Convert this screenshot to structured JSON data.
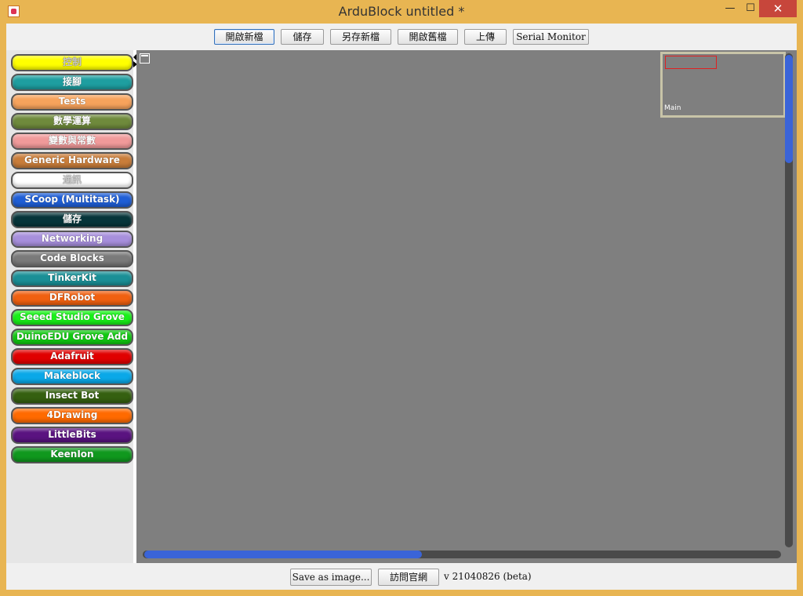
{
  "window": {
    "title": "ArduBlock untitled *"
  },
  "titlebar": {
    "minimize": "—",
    "maximize": "☐",
    "close": "✕"
  },
  "toolbar": {
    "buttons": [
      {
        "label": "開啟新檔"
      },
      {
        "label": "儲存"
      },
      {
        "label": "另存新檔"
      },
      {
        "label": "開啟舊檔"
      },
      {
        "label": "上傳"
      },
      {
        "label": "Serial Monitor"
      }
    ]
  },
  "palette": {
    "categories": [
      {
        "label": "控制",
        "color": "#ffff00"
      },
      {
        "label": "接腳",
        "color": "#1e9ea0"
      },
      {
        "label": "Tests",
        "color": "#f7a35c"
      },
      {
        "label": "數學運算",
        "color": "#6f8a3c"
      },
      {
        "label": "變數與常數",
        "color": "#f09a9a"
      },
      {
        "label": "Generic Hardware",
        "color": "#c97d3a"
      },
      {
        "label": "通訊",
        "color": "#ffffff"
      },
      {
        "label": "SCoop (Multitask)",
        "color": "#1f5ed6"
      },
      {
        "label": "儲存",
        "color": "#06353a"
      },
      {
        "label": "Networking",
        "color": "#a78fdc"
      },
      {
        "label": "Code Blocks",
        "color": "#7a7a7a"
      },
      {
        "label": "TinkerKit",
        "color": "#1a8f96"
      },
      {
        "label": "DFRobot",
        "color": "#f06010"
      },
      {
        "label": "Seeed Studio Grove",
        "color": "#18f018"
      },
      {
        "label": "DuinoEDU Grove Add",
        "color": "#10c810"
      },
      {
        "label": "Adafruit",
        "color": "#e00000"
      },
      {
        "label": "Makeblock",
        "color": "#0aa8e8"
      },
      {
        "label": "Insect Bot",
        "color": "#356010"
      },
      {
        "label": "4Drawing",
        "color": "#ff6a00"
      },
      {
        "label": "LittleBits",
        "color": "#5a1380"
      },
      {
        "label": "KeenIon",
        "color": "#10981e"
      }
    ]
  },
  "canvas": {
    "minimap_label": "Main"
  },
  "bottombar": {
    "save_image": "Save as image...",
    "visit_site": "訪問官網",
    "version": "v 21040826 (beta)"
  }
}
